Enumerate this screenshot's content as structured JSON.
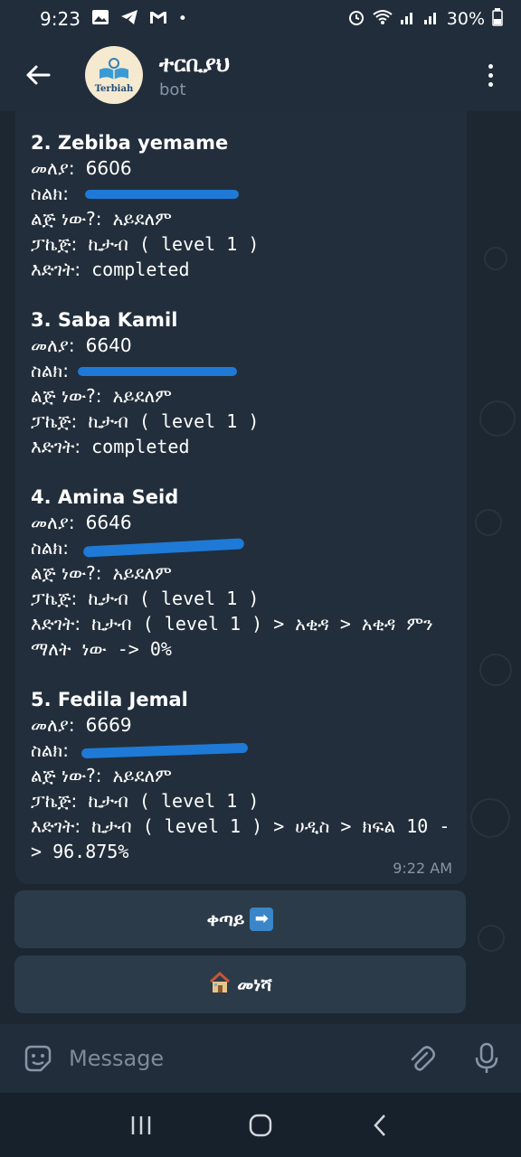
{
  "status": {
    "time": "9:23",
    "battery": "30%"
  },
  "header": {
    "title": "ተርቢያህ",
    "subtitle": "bot",
    "avatar_text": "Terbiah"
  },
  "message": {
    "timestamp": "9:22 AM",
    "entries": [
      {
        "name": "2. Zebiba yemame",
        "id_label": "መለያ:",
        "id_value": "6606",
        "phone_label": "ስልክ:",
        "child_label": "ልጅ ነው?:",
        "child_value": "አይደለም",
        "package_label": "ፓኬጅ:",
        "package_value": "ኪታብ ( level 1 )",
        "progress_label": "እድገት:",
        "progress_value": "completed"
      },
      {
        "name": "3. Saba Kamil",
        "id_label": "መለያ:",
        "id_value": "6640",
        "phone_label": "ስልክ:",
        "child_label": "ልጅ ነው?:",
        "child_value": "አይደለም",
        "package_label": "ፓኬጅ:",
        "package_value": "ኪታብ ( level 1 )",
        "progress_label": "እድገት:",
        "progress_value": "completed"
      },
      {
        "name": "4. Amina Seid",
        "id_label": "መለያ:",
        "id_value": "6646",
        "phone_label": "ስልክ:",
        "child_label": "ልጅ ነው?:",
        "child_value": "አይደለም",
        "package_label": "ፓኬጅ:",
        "package_value": "ኪታብ ( level 1 )",
        "progress_label": "እድገት:",
        "progress_value": "ኪታብ ( level 1 ) > አቂዳ > አቂዳ ምን ማለት ነው -> 0%"
      },
      {
        "name": "5. Fedila Jemal",
        "id_label": "መለያ:",
        "id_value": "6669",
        "phone_label": "ስልክ:",
        "child_label": "ልጅ ነው?:",
        "child_value": "አይደለም",
        "package_label": "ፓኬጅ:",
        "package_value": "ኪታብ ( level 1 )",
        "progress_label": "እድገት:",
        "progress_value": "ኪታብ ( level 1 ) > ሀዲስ > ክፍል 10 -> 96.875%"
      }
    ]
  },
  "buttons": {
    "next_label": "ቀጣይ",
    "home_label": "መነሻ"
  },
  "input": {
    "placeholder": "Message"
  }
}
